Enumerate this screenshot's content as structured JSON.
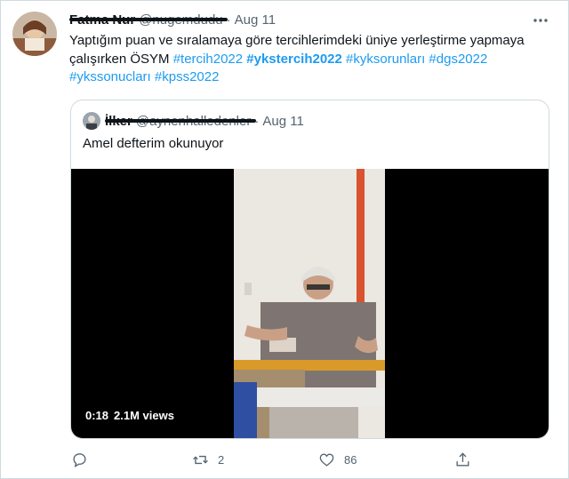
{
  "tweet": {
    "author_name": "Fatma Nur",
    "author_handle": "@nugemdudu",
    "separator": "·",
    "time": "Aug 11",
    "text_plain": "Yaptığım puan ve sıralamaya göre tercihlerimdeki üniye yerleştirme yapmaya çalışırken ÖSYM",
    "hashtags": [
      "#tercih2022",
      "#ykstercih2022",
      "#kyksorunları",
      "#dgs2022",
      "#ykssonucları",
      "#kpss2022"
    ],
    "avatar_icon": "user-avatar-photo",
    "more_icon": "more-dots-icon"
  },
  "quoted": {
    "author_name": "İlker",
    "author_handle": "@aynenhalledenler",
    "separator": "·",
    "time": "Aug 11",
    "text": "Amel defterim okunuyor",
    "video": {
      "duration": "0:18",
      "views": "2.1M views"
    }
  },
  "actions": {
    "reply_icon": "reply-icon",
    "retweet_icon": "retweet-icon",
    "retweet_count": "2",
    "like_icon": "heart-icon",
    "like_count": "86",
    "share_icon": "share-icon"
  },
  "colors": {
    "link": "#1d9bf0",
    "secondary_text": "#536471",
    "border": "#cfd9de"
  }
}
